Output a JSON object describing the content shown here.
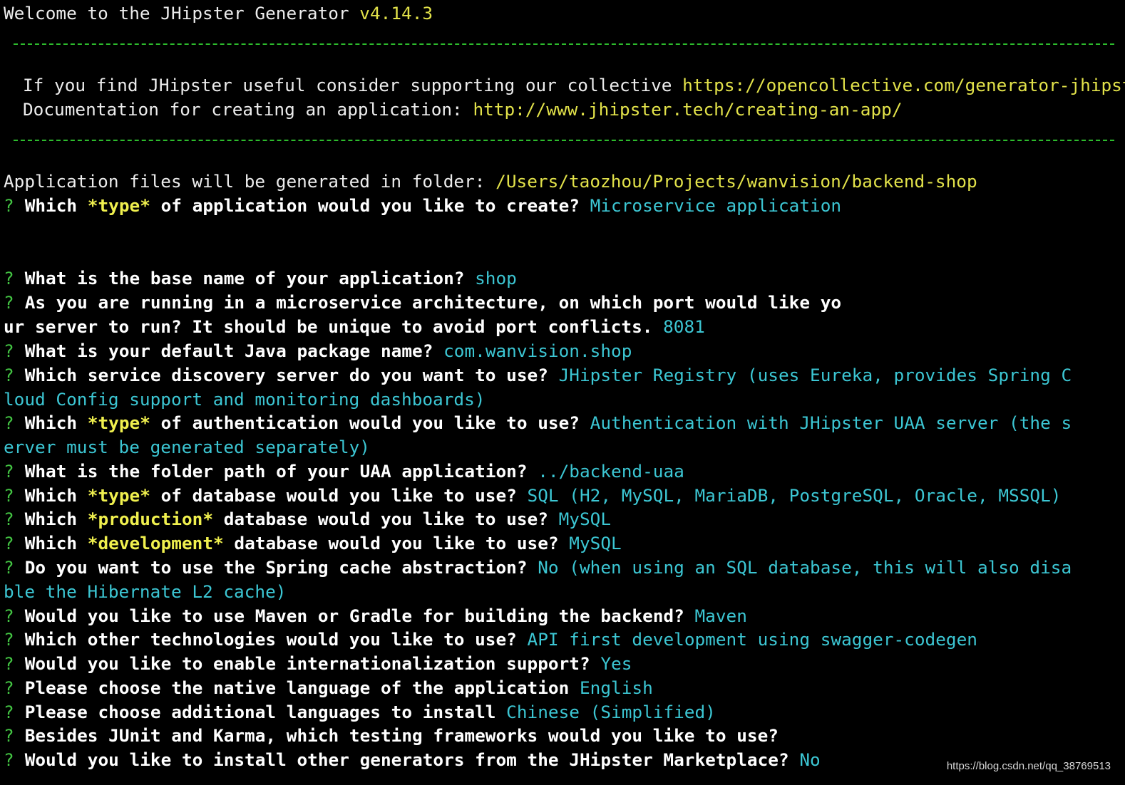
{
  "welcome": {
    "text": "Welcome to the JHipster Generator ",
    "version": "v4.14.3"
  },
  "info": {
    "support_text": "If you find JHipster useful consider supporting our collective ",
    "support_url": "https://opencollective.com/generator-jhipster",
    "docs_text": "Documentation for creating an application: ",
    "docs_url": "http://www.jhipster.tech/creating-an-app/"
  },
  "folder": {
    "text": "Application files will be generated in folder: ",
    "path": "/Users/taozhou/Projects/wanvision/backend-shop"
  },
  "prompt_mark": "?",
  "prompts": {
    "app_type": {
      "q1": "Which ",
      "em": "*type*",
      "q2": " of application would you like to create? ",
      "answer": "Microservice application"
    },
    "base_name": {
      "q": "What is the base name of your application? ",
      "answer": "shop"
    },
    "port": {
      "q_line1": "As you are running in a microservice architecture, on which port would like yo",
      "q_line2": "ur server to run? It should be unique to avoid port conflicts. ",
      "answer": "8081"
    },
    "package": {
      "q": "What is your default Java package name? ",
      "answer": "com.wanvision.shop"
    },
    "discovery": {
      "q": "Which service discovery server do you want to use? ",
      "answer_line1": "JHipster Registry (uses Eureka, provides Spring C",
      "answer_line2": "loud Config support and monitoring dashboards)"
    },
    "auth": {
      "q1": "Which ",
      "em": "*type*",
      "q2": " of authentication would you like to use? ",
      "answer_line1": "Authentication with JHipster UAA server (the s",
      "answer_line2": "erver must be generated separately)"
    },
    "uaa_path": {
      "q": "What is the folder path of your UAA application? ",
      "answer": "../backend-uaa"
    },
    "db_type": {
      "q1": "Which ",
      "em": "*type*",
      "q2": " of database would you like to use? ",
      "answer": "SQL (H2, MySQL, MariaDB, PostgreSQL, Oracle, MSSQL)"
    },
    "prod_db": {
      "q1": "Which ",
      "em": "*production*",
      "q2": " database would you like to use? ",
      "answer": "MySQL"
    },
    "dev_db": {
      "q1": "Which ",
      "em": "*development*",
      "q2": " database would you like to use? ",
      "answer": "MySQL"
    },
    "cache": {
      "q": "Do you want to use the Spring cache abstraction? ",
      "answer_line1": "No (when using an SQL database, this will also disa",
      "answer_line2": "ble the Hibernate L2 cache)"
    },
    "build": {
      "q": "Would you like to use Maven or Gradle for building the backend? ",
      "answer": "Maven"
    },
    "tech": {
      "q": "Which other technologies would you like to use? ",
      "answer": "API first development using swagger-codegen"
    },
    "i18n": {
      "q": "Would you like to enable internationalization support? ",
      "answer": "Yes"
    },
    "native_lang": {
      "q": "Please choose the native language of the application ",
      "answer": "English"
    },
    "add_lang": {
      "q": "Please choose additional languages to install ",
      "answer": "Chinese (Simplified)"
    },
    "testing": {
      "q": "Besides JUnit and Karma, which testing frameworks would you like to use?"
    },
    "marketplace": {
      "q": "Would you like to install other generators from the JHipster Marketplace? ",
      "answer": "No"
    }
  },
  "watermark": "https://blog.csdn.net/qq_38769513",
  "colors": {
    "background": "#000000",
    "text": "#ececec",
    "yellow": "#e2e24a",
    "cyan": "#3cc6d3",
    "green": "#43c443"
  }
}
